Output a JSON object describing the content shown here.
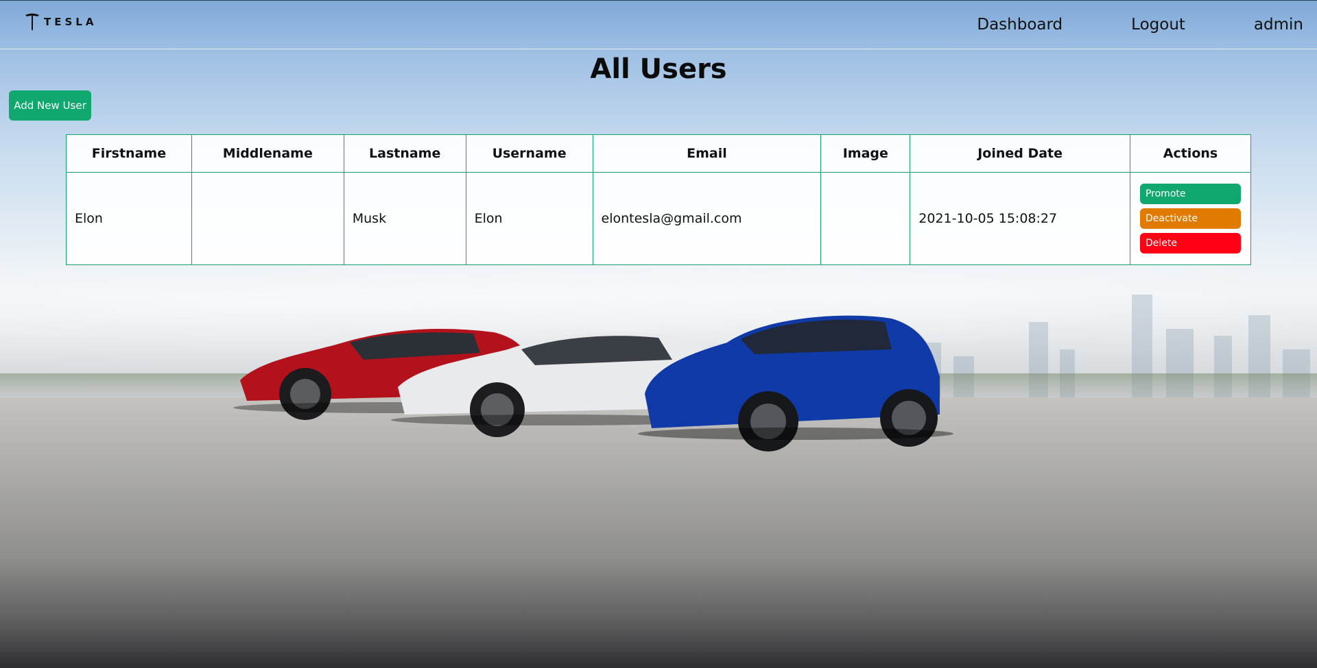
{
  "brand": {
    "logo_text": "TESLA"
  },
  "nav": {
    "dashboard": "Dashboard",
    "logout": "Logout",
    "user": "admin"
  },
  "page": {
    "title": "All Users",
    "add_button": "Add New User"
  },
  "table": {
    "headers": [
      "Firstname",
      "Middlename",
      "Lastname",
      "Username",
      "Email",
      "Image",
      "Joined Date",
      "Actions"
    ],
    "rows": [
      {
        "firstname": "Elon",
        "middlename": "",
        "lastname": "Musk",
        "username": "Elon",
        "email": "elontesla@gmail.com",
        "image": "",
        "joined": "2021-10-05 15:08:27",
        "actions": [
          "Promote",
          "Deactivate",
          "Delete"
        ]
      }
    ]
  },
  "colors": {
    "accent_green": "#10a86f",
    "warning_orange": "#e17b00",
    "danger_red": "#ff0015",
    "table_border": "#18a06c"
  }
}
